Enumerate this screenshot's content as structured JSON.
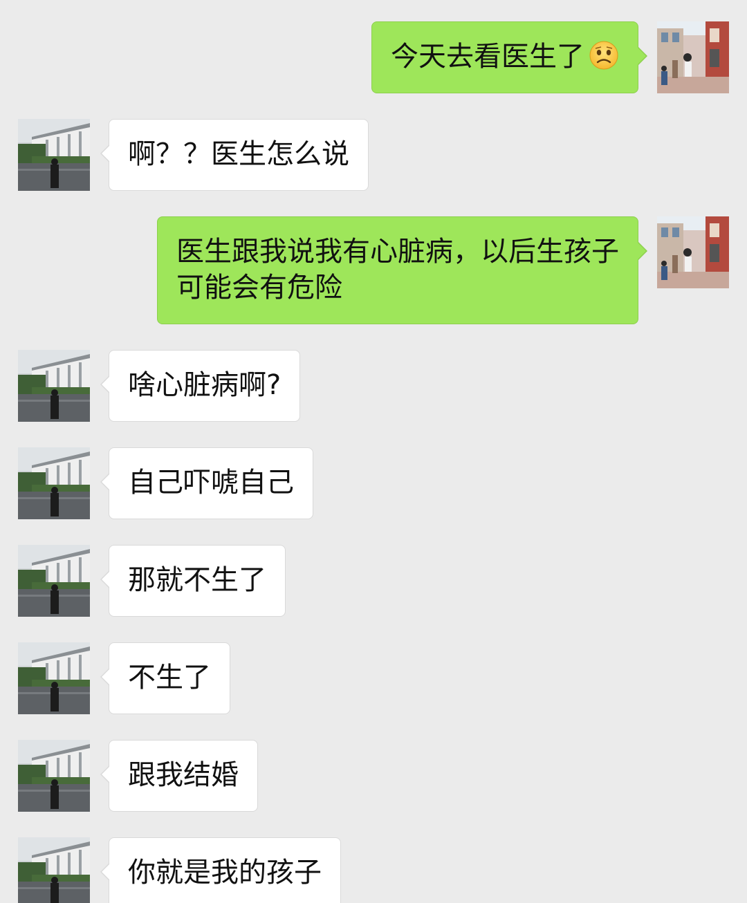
{
  "conversation": {
    "messages": [
      {
        "sender": "self",
        "text": "今天去看医生了",
        "emoji": "frowning-face-icon"
      },
      {
        "sender": "contact",
        "text": "啊？？医生怎么说"
      },
      {
        "sender": "self",
        "text": "医生跟我说我有心脏病，以后生孩子\n可能会有危险"
      },
      {
        "sender": "contact",
        "text": "啥心脏病啊?"
      },
      {
        "sender": "contact",
        "text": "自己吓唬自己"
      },
      {
        "sender": "contact",
        "text": "那就不生了"
      },
      {
        "sender": "contact",
        "text": "不生了"
      },
      {
        "sender": "contact",
        "text": "跟我结婚"
      },
      {
        "sender": "contact",
        "text": "你就是我的孩子"
      }
    ]
  },
  "colors": {
    "background": "#ebebeb",
    "outgoing_bubble": "#9ee65a",
    "incoming_bubble": "#ffffff",
    "text": "#111111"
  }
}
